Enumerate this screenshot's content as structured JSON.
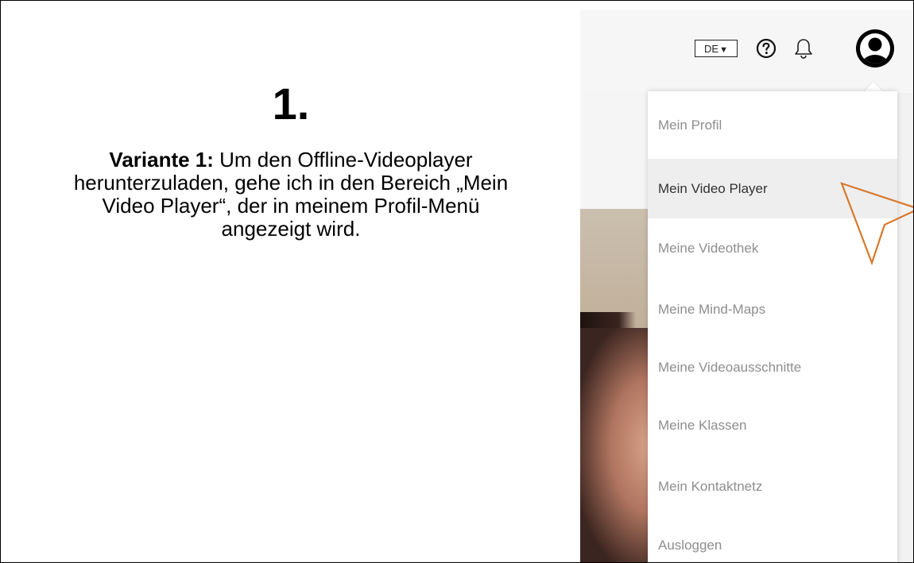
{
  "instruction": {
    "step_number": "1.",
    "lead_bold": "Variante 1:",
    "body": " Um den Offline-Videoplayer herunterzuladen, gehe ich in den Bereich „Mein Video Player“, der in meinem Profil-Menü angezeigt wird."
  },
  "topbar": {
    "language": "DE",
    "language_arrow": "▼"
  },
  "profile_menu": {
    "items": [
      {
        "label": "Mein Profil"
      },
      {
        "label": "Mein Video Player",
        "active": true
      },
      {
        "label": "Meine Videothek"
      },
      {
        "label": "Meine Mind-Maps"
      },
      {
        "label": "Meine Videoausschnitte"
      },
      {
        "label": "Meine Klassen"
      },
      {
        "label": "Mein Kontaktnetz"
      },
      {
        "label": "Ausloggen"
      }
    ]
  },
  "colors": {
    "pointer_outline": "#d9782a",
    "menu_text": "#8e8e8e",
    "menu_text_active": "#333333",
    "menu_active_bg": "#eeeeee"
  },
  "icons": [
    "help-icon",
    "bell-icon",
    "user-account-icon",
    "cursor-arrow-icon"
  ]
}
